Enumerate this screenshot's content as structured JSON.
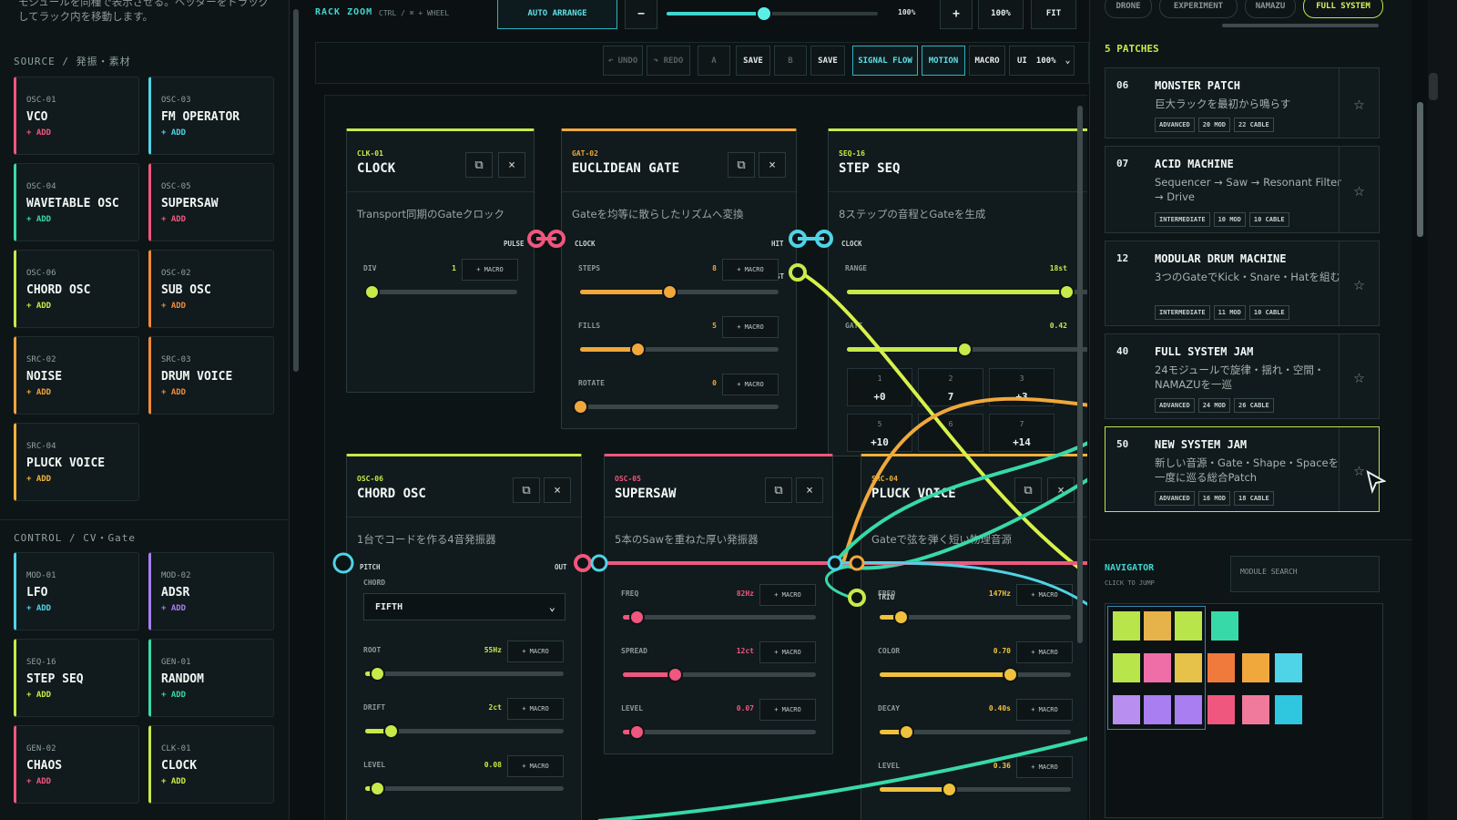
{
  "sidebar": {
    "intro": "モジュールを同種で表示させる。ヘッダーをドラッグしてラック内を移動します。",
    "source_title": "SOURCE / 発振・素材",
    "control_title": "CONTROL / CV・Gate",
    "add_label": "+ ADD",
    "source_modules": [
      {
        "code": "OSC-01",
        "name": "VCO",
        "color": "#f0577e"
      },
      {
        "code": "OSC-03",
        "name": "FM OPERATOR",
        "color": "#4fd3e6"
      },
      {
        "code": "OSC-04",
        "name": "WAVETABLE OSC",
        "color": "#37d9a8"
      },
      {
        "code": "OSC-05",
        "name": "SUPERSAW",
        "color": "#f0577e"
      },
      {
        "code": "OSC-06",
        "name": "CHORD OSC",
        "color": "#c7ea4a"
      },
      {
        "code": "OSC-02",
        "name": "SUB OSC",
        "color": "#f08a3c"
      },
      {
        "code": "SRC-02",
        "name": "NOISE",
        "color": "#f0a23c"
      },
      {
        "code": "SRC-03",
        "name": "DRUM VOICE",
        "color": "#f08a3c"
      },
      {
        "code": "SRC-04",
        "name": "PLUCK VOICE",
        "color": "#f0b23c"
      }
    ],
    "control_modules": [
      {
        "code": "MOD-01",
        "name": "LFO",
        "color": "#4fd3e6"
      },
      {
        "code": "MOD-02",
        "name": "ADSR",
        "color": "#a87ef0"
      },
      {
        "code": "SEQ-16",
        "name": "STEP SEQ",
        "color": "#c7ea4a"
      },
      {
        "code": "GEN-01",
        "name": "RANDOM",
        "color": "#37d9a8"
      },
      {
        "code": "GEN-02",
        "name": "CHAOS",
        "color": "#f0577e"
      },
      {
        "code": "CLK-01",
        "name": "CLOCK",
        "color": "#c7ea4a"
      }
    ]
  },
  "toolbar": {
    "rack_zoom": "RACK ZOOM",
    "zoom_hint": "CTRL / ⌘ + WHEEL",
    "auto_arrange": "AUTO ARRANGE",
    "minus": "−",
    "plus": "+",
    "zoom_value": "100%",
    "zoom_reset": "100%",
    "fit": "FIT",
    "zoom_level": 0.46,
    "undo": "↶ UNDO",
    "redo": "↷ REDO",
    "slot_a": "A",
    "save_a": "SAVE",
    "slot_b": "B",
    "save_b": "SAVE",
    "signal_flow": "SIGNAL FLOW",
    "motion": "MOTION",
    "macro": "MACRO",
    "ui_label": "UI",
    "ui_scale": "100%"
  },
  "modules": {
    "clock": {
      "code": "CLK-01",
      "name": "CLOCK",
      "desc": "Transport同期のGateクロック",
      "port_out": "PULSE",
      "param": "DIV",
      "value": "1",
      "macro": "+ MACRO",
      "level": 0.0
    },
    "gate": {
      "code": "GAT-02",
      "name": "EUCLIDEAN GATE",
      "desc": "Gateを均等に散らしたリズムへ変換",
      "port_in": "CLOCK",
      "port_out": "HIT",
      "port_rest": "REST",
      "params": [
        {
          "label": "STEPS",
          "value": "8",
          "level": 0.45
        },
        {
          "label": "FILLS",
          "value": "5",
          "level": 0.29
        },
        {
          "label": "ROTATE",
          "value": "0",
          "level": 0.0
        }
      ],
      "macro": "+ MACRO"
    },
    "seq": {
      "code": "SEQ-16",
      "name": "STEP SEQ",
      "desc": "8ステップの音程とGateを生成",
      "port_in": "CLOCK",
      "params": [
        {
          "label": "RANGE",
          "value": "18st",
          "level": 0.86
        },
        {
          "label": "GATE",
          "value": "0.42",
          "level": 0.46
        }
      ],
      "steps": [
        {
          "n": "1",
          "v": "+0"
        },
        {
          "n": "2",
          "v": "7"
        },
        {
          "n": "3",
          "v": "+3"
        },
        {
          "n": "5",
          "v": "+10"
        },
        {
          "n": "6",
          "v": ""
        },
        {
          "n": "7",
          "v": "+14"
        }
      ]
    },
    "chord": {
      "code": "OSC-06",
      "name": "CHORD OSC",
      "desc": "1台でコードを作る4音発振器",
      "port_in": "PITCH",
      "port_out": "OUT",
      "chord_label": "CHORD",
      "chord_value": "FIFTH",
      "params": [
        {
          "label": "ROOT",
          "value": "55Hz",
          "level": 0.06
        },
        {
          "label": "DRIFT",
          "value": "2ct",
          "level": 0.13
        },
        {
          "label": "LEVEL",
          "value": "0.08",
          "level": 0.06
        }
      ],
      "macro": "+ MACRO"
    },
    "supersaw": {
      "code": "OSC-05",
      "name": "SUPERSAW",
      "desc": "5本のSawを重ねた厚い発振器",
      "params": [
        {
          "label": "FREQ",
          "value": "82Hz",
          "level": 0.07
        },
        {
          "label": "SPREAD",
          "value": "12ct",
          "level": 0.27
        },
        {
          "label": "LEVEL",
          "value": "0.07",
          "level": 0.07
        }
      ],
      "macro": "+ MACRO"
    },
    "pluck": {
      "code": "SRC-04",
      "name": "PLUCK VOICE",
      "desc": "Gateで弦を弾く短い物理音源",
      "port_trig": "TRIG",
      "params": [
        {
          "label": "FREQ",
          "value": "147Hz",
          "level": 0.11
        },
        {
          "label": "COLOR",
          "value": "0.70",
          "level": 0.68
        },
        {
          "label": "DECAY",
          "value": "0.40s",
          "level": 0.14
        },
        {
          "label": "LEVEL",
          "value": "0.36",
          "level": 0.36
        }
      ],
      "macro": "+ MACRO"
    }
  },
  "right_panel": {
    "tabs": [
      "DRONE",
      "EXPERIMENT",
      "NAMAZU",
      "FULL SYSTEM"
    ],
    "patch_count": "5 PATCHES",
    "patches": [
      {
        "num": "06",
        "name": "MONSTER PATCH",
        "desc": "巨大ラックを最初から鳴らす",
        "tags": [
          "ADVANCED",
          "20 MOD",
          "22 CABLE"
        ]
      },
      {
        "num": "07",
        "name": "ACID MACHINE",
        "desc": "Sequencer → Saw → Resonant Filter → Drive",
        "tags": [
          "INTERMEDIATE",
          "10 MOD",
          "10 CABLE"
        ]
      },
      {
        "num": "12",
        "name": "MODULAR DRUM MACHINE",
        "desc": "3つのGateでKick・Snare・Hatを組む",
        "tags": [
          "INTERMEDIATE",
          "11 MOD",
          "10 CABLE"
        ]
      },
      {
        "num": "40",
        "name": "FULL SYSTEM JAM",
        "desc": "24モジュールで旋律・揺れ・空間・NAMAZUを一巡",
        "tags": [
          "ADVANCED",
          "24 MOD",
          "26 CABLE"
        ]
      },
      {
        "num": "50",
        "name": "NEW SYSTEM JAM",
        "desc": "新しい音源・Gate・Shape・Spaceを一度に巡る総合Patch",
        "tags": [
          "ADVANCED",
          "16 MOD",
          "18 CABLE"
        ]
      }
    ],
    "star": "☆",
    "navigator_title": "NAVIGATOR",
    "navigator_hint": "CLICK TO JUMP",
    "search_placeholder": "MODULE SEARCH",
    "nav_colors": [
      "#b8e64a",
      "#e6b24a",
      "#b8e64a",
      "#37d9a8",
      "#b8e64a",
      "#f06ea8",
      "#e6c24a",
      "#f07a3c",
      "#f0a83c",
      "#4fd3e6",
      "#b88ef0",
      "#a87ef0",
      "#a87ef0",
      "#f0577e",
      "#f07a9c",
      "#2fc6e0",
      "#f0577e"
    ]
  },
  "colors": {
    "lime": "#c7ea4a",
    "orange": "#f0a83c",
    "pink": "#f0577e",
    "cyan": "#4fd3e6",
    "teal": "#37d9a8",
    "yellow": "#f0c23c"
  }
}
